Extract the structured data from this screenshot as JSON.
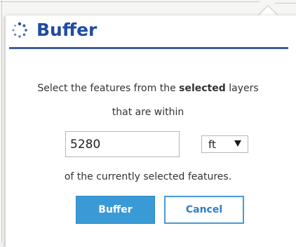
{
  "dialog": {
    "title": "Buffer",
    "instruction_prefix": "Select the features from the ",
    "instruction_bold": "selected",
    "instruction_suffix": " layers",
    "line2": "that are within",
    "distance_value": "5280",
    "unit_selected": "ft",
    "line3": "of the currently selected features.",
    "buffer_button": "Buffer",
    "cancel_button": "Cancel"
  },
  "icons": {
    "title_icon": "spinner-icon",
    "unit_arrow": "dropdown-arrow-icon"
  },
  "colors": {
    "title": "#1f4ea0",
    "rule": "#3f5f9a",
    "primary_button": "#3a9ad6",
    "cancel_text": "#2e7fc4"
  }
}
